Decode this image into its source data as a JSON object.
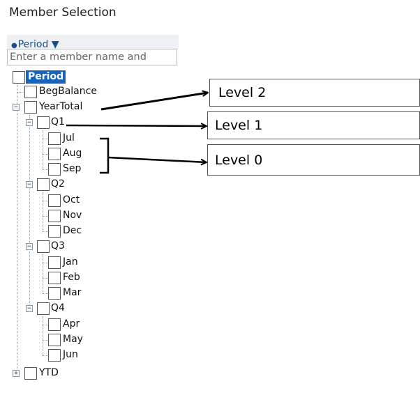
{
  "panel": {
    "title": "Member Selection"
  },
  "dimension_header": {
    "label": "Period ▼"
  },
  "search": {
    "placeholder": "Enter a member name and"
  },
  "tree": {
    "root": "Period",
    "begbalance": "BegBalance",
    "yeartotal": "YearTotal",
    "q1": "Q1",
    "jul": "Jul",
    "aug": "Aug",
    "sep": "Sep",
    "q2": "Q2",
    "oct": "Oct",
    "nov": "Nov",
    "dec": "Dec",
    "q3": "Q3",
    "jan": "Jan",
    "feb": "Feb",
    "mar": "Mar",
    "q4": "Q4",
    "apr": "Apr",
    "may": "May",
    "jun": "Jun",
    "ytd": "YTD",
    "collapse_glyph": "−",
    "expand_glyph": "+"
  },
  "annotations": {
    "level2": "Level 2",
    "level1": "Level 1",
    "level0": "Level 0"
  }
}
